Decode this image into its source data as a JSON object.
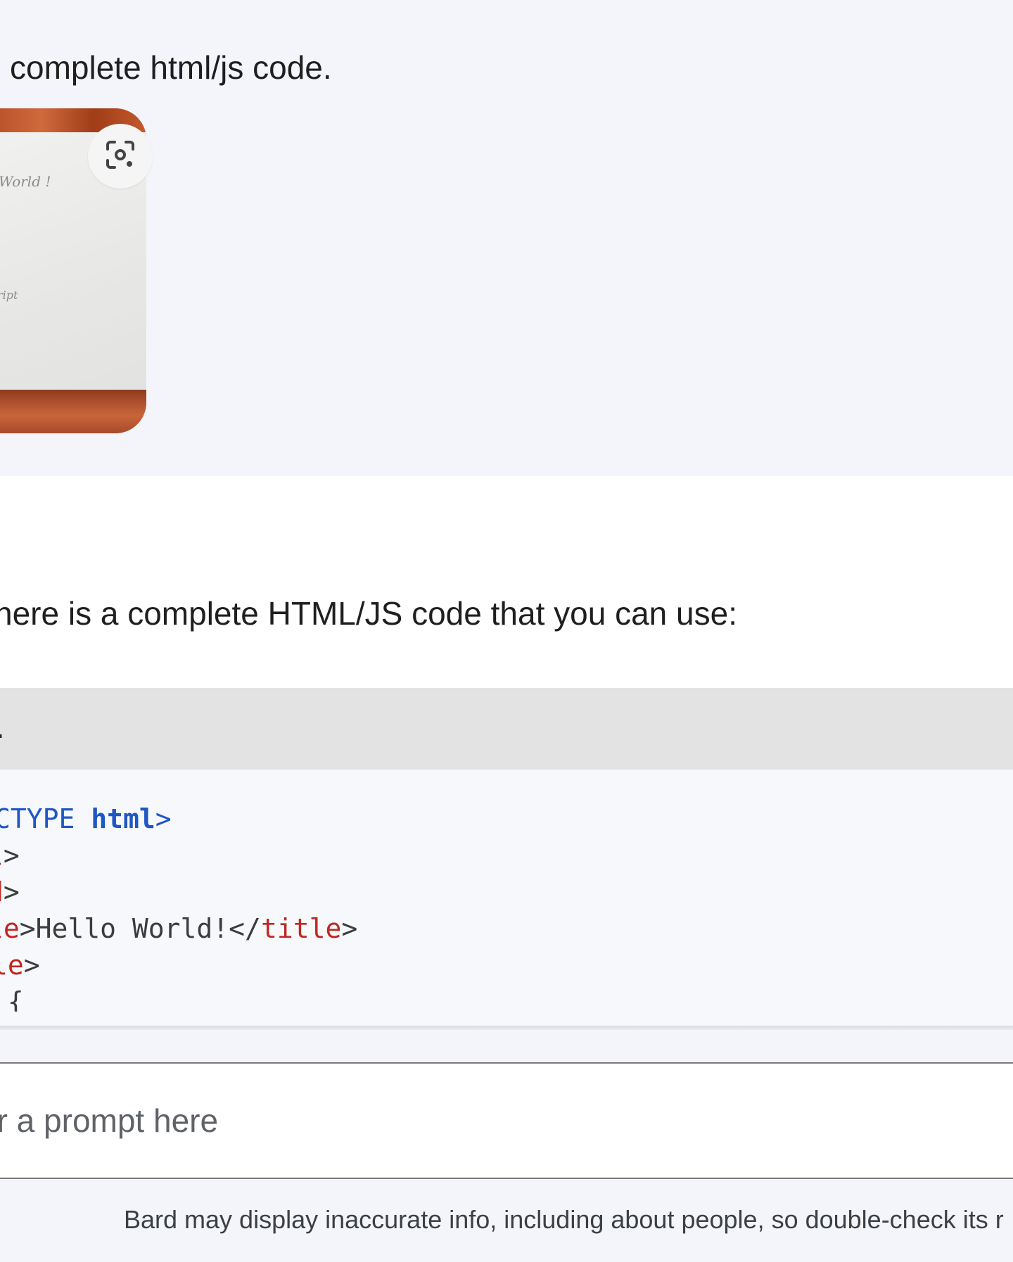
{
  "user_prompt": {
    "text": "complete html/js code.",
    "image": {
      "scribbles": [
        "World !",
        "ript"
      ],
      "lens_button_icon": "google-lens-icon"
    }
  },
  "response": {
    "intro": "here is a complete HTML/JS code that you can use:",
    "code_block": {
      "language": "L",
      "lines": [
        [
          {
            "t": "CTYPE ",
            "c": "blue"
          },
          {
            "t": "html",
            "c": "kw"
          },
          {
            "t": ">",
            "c": "blue"
          }
        ],
        [
          {
            "t": "l",
            "c": "tag"
          },
          {
            "t": ">",
            "c": "plain"
          }
        ],
        [
          {
            "t": "d",
            "c": "tag"
          },
          {
            "t": ">",
            "c": "plain"
          }
        ],
        [
          {
            "t": "le",
            "c": "tag"
          },
          {
            "t": ">Hello World!</",
            "c": "plain"
          },
          {
            "t": "title",
            "c": "tag"
          },
          {
            "t": ">",
            "c": "plain"
          }
        ],
        [
          {
            "t": "le",
            "c": "tag"
          },
          {
            "t": ">",
            "c": "plain"
          }
        ],
        [
          {
            "t": " {",
            "c": "plain"
          }
        ]
      ]
    }
  },
  "input": {
    "placeholder": "er a prompt here"
  },
  "footer": {
    "disclaimer": "Bard may display inaccurate info, including about people, so double-check its r"
  },
  "colors": {
    "keyword_blue": "#1f57c3",
    "tag_red": "#c1271f",
    "user_bg": "#f4f5fb",
    "code_header_bg": "#e3e3e3"
  }
}
